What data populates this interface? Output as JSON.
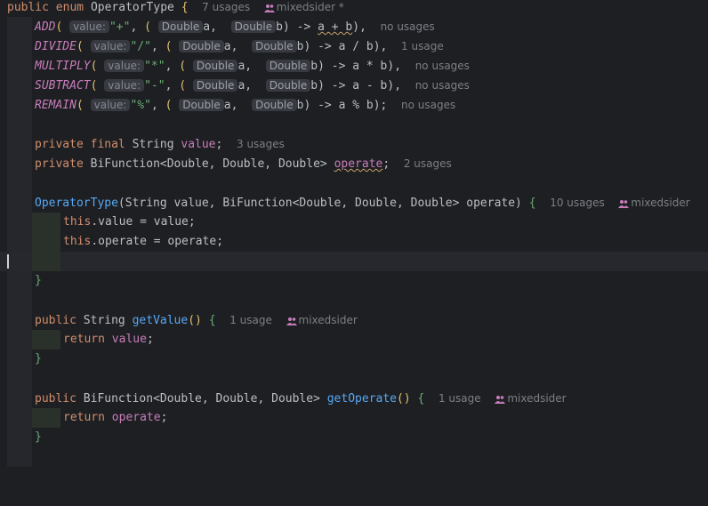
{
  "header": {
    "kw_public": "public",
    "kw_enum": "enum",
    "name": "OperatorType",
    "brace": "{",
    "usages": "7 usages",
    "author": "mixedsider *"
  },
  "enum_values": [
    {
      "name": "ADD",
      "hint_key": "value:",
      "symbol": "\"+\"",
      "a_op_b": "a + b",
      "tail": "),",
      "usages": "no usages"
    },
    {
      "name": "DIVIDE",
      "hint_key": "value:",
      "symbol": "\"/\"",
      "a_op_b": "a / b",
      "tail": "),",
      "usages": "1 usage"
    },
    {
      "name": "MULTIPLY",
      "hint_key": "value:",
      "symbol": "\"*\"",
      "a_op_b": "a * b",
      "tail": "),",
      "usages": "no usages"
    },
    {
      "name": "SUBTRACT",
      "hint_key": "value:",
      "symbol": "\"-\"",
      "a_op_b": "a - b",
      "tail": "),",
      "usages": "no usages"
    },
    {
      "name": "REMAIN",
      "hint_key": "value:",
      "symbol": "\"%\"",
      "a_op_b": "a % b",
      "tail": ");",
      "usages": "no usages"
    }
  ],
  "hint_type": "Double",
  "field_value": {
    "modifiers": "private final",
    "type": "String",
    "name": "value",
    "usages": "3 usages"
  },
  "field_operate": {
    "modifiers": "private",
    "type": "BiFunction<Double, Double, Double>",
    "name": "operate",
    "usages": "2 usages"
  },
  "constructor": {
    "name": "OperatorType",
    "params": "String value, BiFunction<Double, Double, Double> operate",
    "usages": "10 usages",
    "author": "mixedsider",
    "body1_this": "this",
    "body1_rest": ".value = value;",
    "body2_this": "this",
    "body2_rest": ".operate = operate;"
  },
  "getValue": {
    "modifiers": "public",
    "type": "String",
    "name": "getValue",
    "usages": "1 usage",
    "author": "mixedsider",
    "ret_kw": "return",
    "ret_val": "value"
  },
  "getOperate": {
    "modifiers": "public",
    "type": "BiFunction<Double, Double, Double>",
    "name": "getOperate",
    "usages": "1 usage",
    "author": "mixedsider",
    "ret_kw": "return",
    "ret_val": "operate"
  },
  "icons": {
    "user": "user-group-icon"
  },
  "colors": {
    "background": "#1e1f22",
    "keyword": "#cf8e6d",
    "function": "#56a8f5",
    "field": "#c77dbb",
    "string": "#6aab73"
  }
}
